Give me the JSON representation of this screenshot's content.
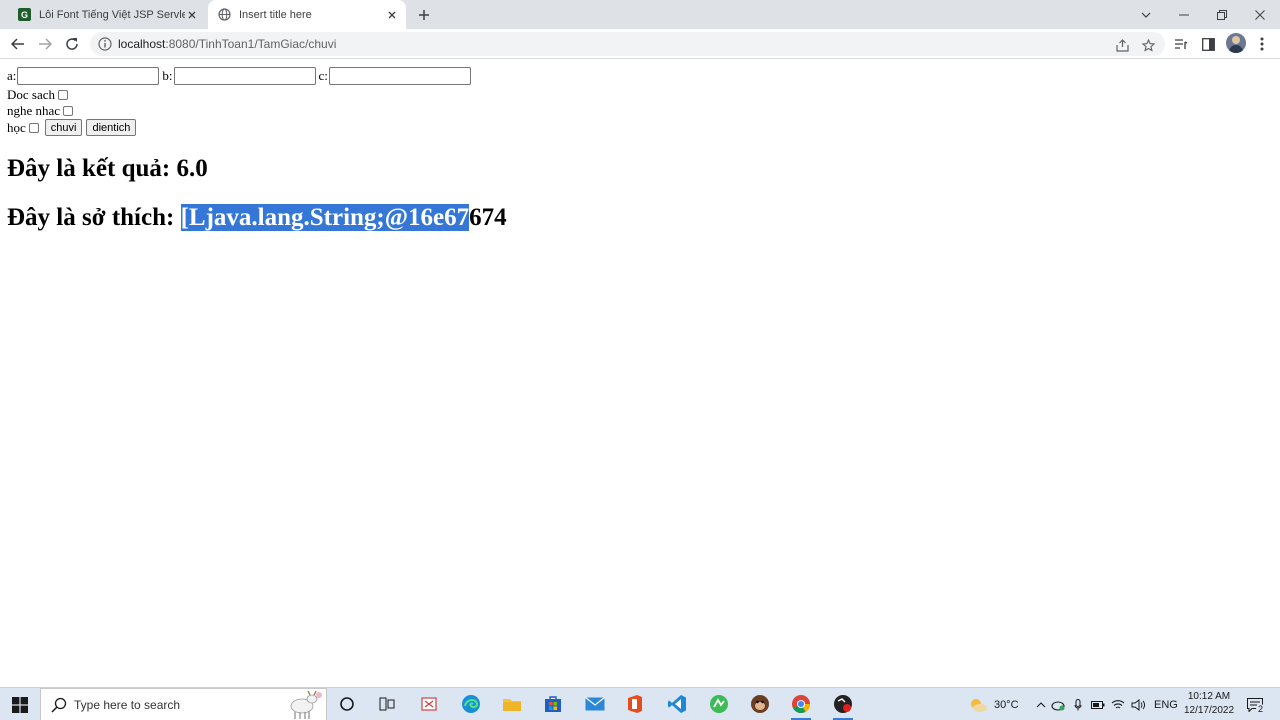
{
  "browser": {
    "tabs": [
      {
        "title": "Lỗi Font Tiếng Việt JSP Servlet Cách",
        "favicon": "green-g-icon",
        "active": false
      },
      {
        "title": "Insert title here",
        "favicon": "globe-icon",
        "active": true
      }
    ],
    "address": {
      "host": "localhost",
      "path": ":8080/TinhToan1/TamGiac/chuvi"
    }
  },
  "form": {
    "labels": {
      "a": "a:",
      "b": "b:",
      "c": "c:"
    },
    "values": {
      "a": "",
      "b": "",
      "c": ""
    },
    "checkboxes": [
      {
        "label": "Doc sach",
        "checked": false
      },
      {
        "label": "nghe nhac",
        "checked": false
      },
      {
        "label": "học",
        "checked": false
      }
    ],
    "buttons": {
      "chuvi": "chuvi",
      "dientich": "dientich"
    }
  },
  "results": {
    "ketqua_prefix": "Đây là kết quả: ",
    "ketqua_value": "6.0",
    "sothich_prefix": "Đây là sở thích: ",
    "sothich_selected": "[Ljava.lang.String;@16e67",
    "sothich_rest": "674"
  },
  "taskbar": {
    "search_placeholder": "Type here to search",
    "weather": "30°C",
    "language": "ENG",
    "time": "10:12 AM",
    "date": "12/17/2022",
    "notification_count": "2"
  },
  "colors": {
    "selection": "#3477d6",
    "tabstrip": "#dee1e6",
    "taskbar": "#dce6f2"
  }
}
